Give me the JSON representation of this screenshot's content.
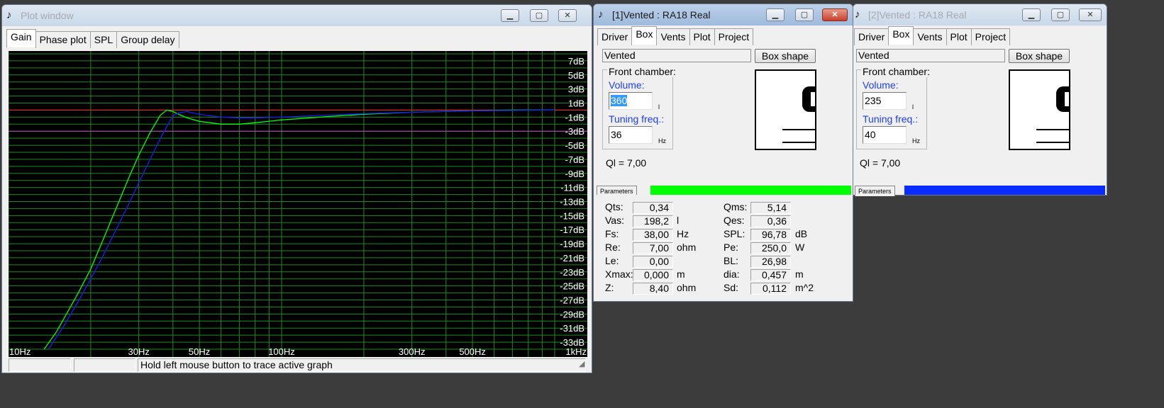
{
  "colors": {
    "plot_bg": "#000000",
    "grid": "#1e8a1e",
    "axis_text": "#ffffff",
    "curve1": "#00ff00",
    "curve2": "#1a1aff",
    "ref_red": "#ff2020",
    "ref_magenta": "#c040c0",
    "strip1": "#00ff00",
    "strip2": "#0a2bff"
  },
  "plot_window": {
    "title": "Plot window",
    "icon": "app-icon",
    "tabs": [
      "Gain",
      "Phase plot",
      "SPL",
      "Group delay"
    ],
    "active_tab": "Gain",
    "status": {
      "box1": "",
      "box2": "",
      "message": "Hold left mouse button to trace active graph"
    }
  },
  "window1": {
    "title": "[1]Vented : RA18 Real",
    "tabs": [
      "Driver",
      "Box",
      "Vents",
      "Plot",
      "Project"
    ],
    "active_tab": "Box",
    "box_type": "Vented",
    "box_shape_button": "Box shape",
    "front_chamber_label": "Front chamber:",
    "volume_label": "Volume:",
    "volume_value": "360",
    "volume_unit": "l",
    "tuning_label": "Tuning freq.:",
    "tuning_value": "36",
    "tuning_unit": "Hz",
    "ql": "Ql = 7,00",
    "params_tab": "Parameters",
    "params": {
      "qts_label": "Qts:",
      "qts": "0,34",
      "vas_label": "Vas:",
      "vas": "198,2",
      "vas_unit": "l",
      "fs_label": "Fs:",
      "fs": "38,00",
      "fs_unit": "Hz",
      "re_label": "Re:",
      "re": "7,00",
      "re_unit": "ohm",
      "le_label": "Le:",
      "le": "0,00",
      "xmax_label": "Xmax:",
      "xmax": "0,000",
      "xmax_unit": "m",
      "z_label": "Z:",
      "z": "8,40",
      "z_unit": "ohm",
      "qms_label": "Qms:",
      "qms": "5,14",
      "qes_label": "Qes:",
      "qes": "0,36",
      "spl_label": "SPL:",
      "spl": "96,78",
      "spl_unit": "dB",
      "pe_label": "Pe:",
      "pe": "250,0",
      "pe_unit": "W",
      "bl_label": "BL:",
      "bl": "26,98",
      "dia_label": "dia:",
      "dia": "0,457",
      "dia_unit": "m",
      "sd_label": "Sd:",
      "sd": "0,112",
      "sd_unit": "m^2"
    }
  },
  "window2": {
    "title": "[2]Vented : RA18 Real",
    "tabs": [
      "Driver",
      "Box",
      "Vents",
      "Plot",
      "Project"
    ],
    "active_tab": "Box",
    "box_type": "Vented",
    "box_shape_button": "Box shape",
    "front_chamber_label": "Front chamber:",
    "volume_label": "Volume:",
    "volume_value": "235",
    "volume_unit": "l",
    "tuning_label": "Tuning freq.:",
    "tuning_value": "40",
    "tuning_unit": "Hz",
    "ql": "Ql = 7,00",
    "params_tab": "Parameters"
  },
  "chart_data": {
    "type": "line",
    "x_scale": "log",
    "xlim": [
      10,
      1000
    ],
    "ylim": [
      -34,
      8
    ],
    "x_tick_labels": [
      "10Hz",
      "30Hz",
      "50Hz",
      "100Hz",
      "300Hz",
      "500Hz",
      "1kHz"
    ],
    "x_tick_values": [
      10,
      30,
      50,
      100,
      300,
      500,
      1000
    ],
    "y_tick_labels": [
      "7dB",
      "5dB",
      "3dB",
      "1dB",
      "-1dB",
      "-3dB",
      "-5dB",
      "-7dB",
      "-9dB",
      "-11dB",
      "-13dB",
      "-15dB",
      "-17dB",
      "-19dB",
      "-21dB",
      "-23dB",
      "-25dB",
      "-27dB",
      "-29dB",
      "-31dB",
      "-33dB"
    ],
    "y_tick_values": [
      7,
      5,
      3,
      1,
      -1,
      -3,
      -5,
      -7,
      -9,
      -11,
      -13,
      -15,
      -17,
      -19,
      -21,
      -23,
      -25,
      -27,
      -29,
      -31,
      -33
    ],
    "grid": true,
    "reference_lines": [
      {
        "y": 0,
        "color": "#ff2020"
      },
      {
        "y": -3,
        "color": "#c040c0"
      }
    ],
    "series": [
      {
        "color": "#00ff00",
        "x": [
          13.5,
          15,
          18,
          20,
          22,
          25,
          28,
          30,
          33,
          36,
          38,
          40,
          42,
          45,
          50,
          60,
          70,
          80,
          100,
          150,
          200,
          300,
          500,
          700,
          1000
        ],
        "y": [
          -34,
          -31.5,
          -26,
          -22.6,
          -18.8,
          -13.6,
          -9,
          -6.4,
          -3.2,
          -0.7,
          0,
          -0.2,
          -0.6,
          -1.1,
          -1.6,
          -2,
          -2,
          -1.8,
          -1.4,
          -0.9,
          -0.6,
          -0.3,
          -0.1,
          0,
          0
        ]
      },
      {
        "color": "#1a1aff",
        "x": [
          14,
          16,
          18,
          20,
          22,
          25,
          28,
          30,
          33,
          36,
          40,
          42,
          45,
          50,
          60,
          70,
          80,
          100,
          150,
          200,
          300,
          500,
          1000
        ],
        "y": [
          -34,
          -30.6,
          -27.2,
          -24,
          -21,
          -16.7,
          -12.8,
          -10.3,
          -7,
          -4,
          -0.8,
          -0.4,
          -0.2,
          -0.6,
          -1,
          -1.1,
          -1.1,
          -1,
          -0.7,
          -0.5,
          -0.3,
          -0.1,
          0
        ]
      }
    ]
  }
}
